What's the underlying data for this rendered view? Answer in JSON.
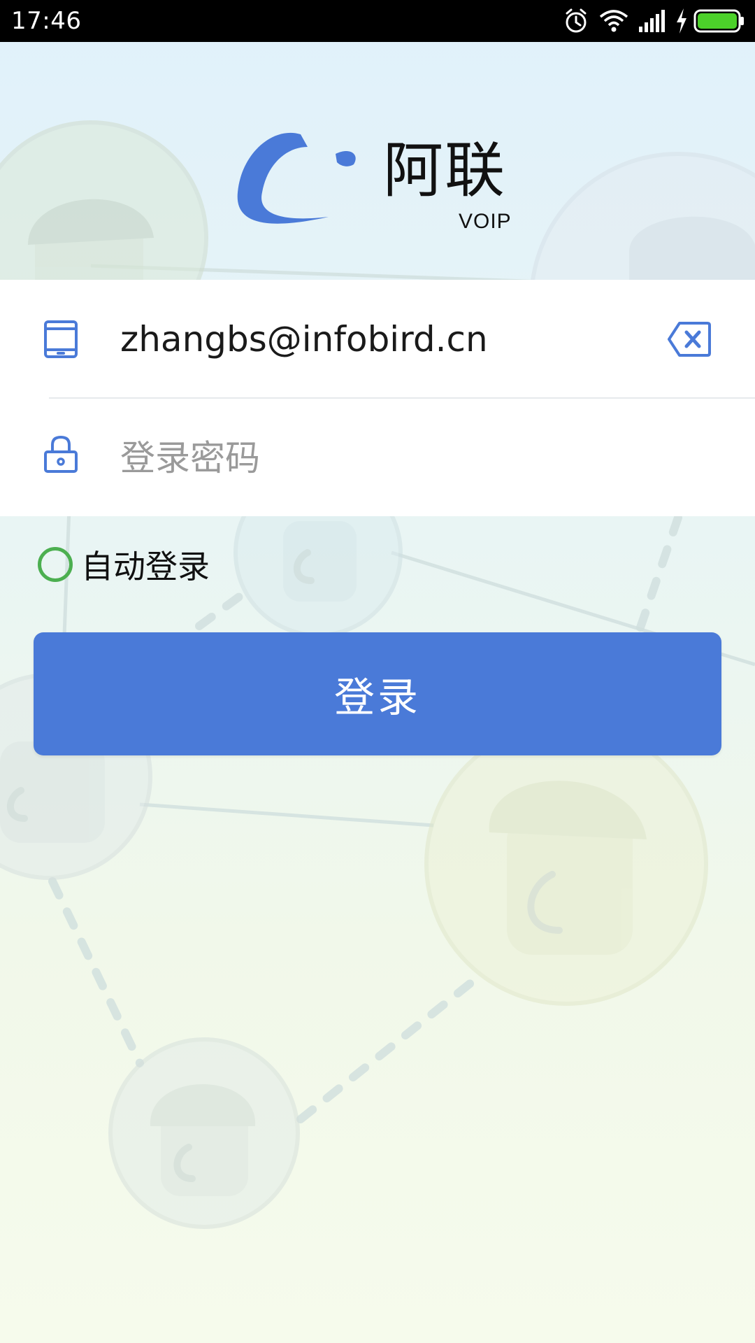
{
  "status_bar": {
    "time": "17:46"
  },
  "logo": {
    "name": "阿联",
    "sub": "VOIP"
  },
  "form": {
    "account_value": "zhangbs@infobird.cn",
    "password_placeholder": "登录密码"
  },
  "auto_login": {
    "label": "自动登录",
    "checked": false
  },
  "login_button": {
    "label": "登录"
  },
  "colors": {
    "accent": "#4a7ad8",
    "radio": "#4caf50",
    "icon": "#4a7ad8"
  }
}
